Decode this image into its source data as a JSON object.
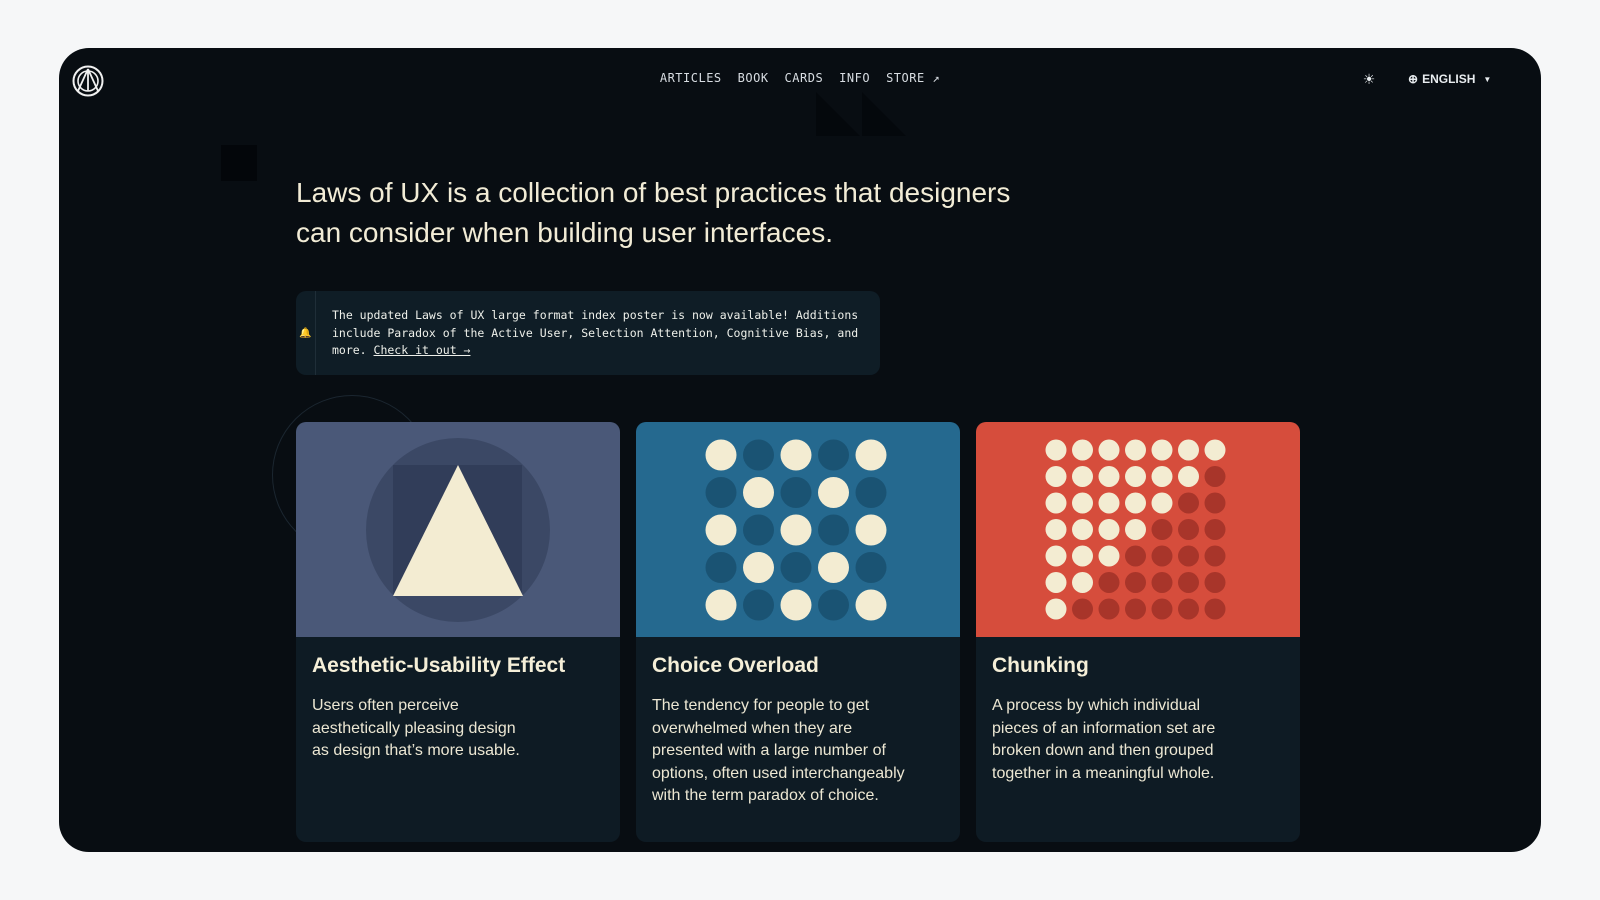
{
  "colors": {
    "background": "#080d12",
    "cream": "#f2ecd6",
    "card_bg": "#0e1b24",
    "card1_art": "#4a5878",
    "card2_art": "#25698f",
    "card3_art": "#d64d3c"
  },
  "header": {
    "logo_icon": "laws-of-ux-logo",
    "nav": [
      {
        "label": "ARTICLES"
      },
      {
        "label": "BOOK"
      },
      {
        "label": "CARDS"
      },
      {
        "label": "INFO"
      },
      {
        "label": "STORE ↗"
      }
    ],
    "theme_icon": "sun-icon",
    "language": "ENGLISH"
  },
  "hero": {
    "text": "Laws of UX is a collection of best practices that designers can consider when building user interfaces."
  },
  "notice": {
    "icon": "bell-icon",
    "text": "The updated Laws of UX large format index poster is now available! Additions include Paradox of the Active User, Selection Attention, Cognitive Bias, and more. ",
    "link": "Check it out →"
  },
  "cards": [
    {
      "title": "Aesthetic-Usability Effect",
      "description": "Users often perceive aesthetically pleasing design as design that’s more usable."
    },
    {
      "title": "Choice Overload",
      "description": "The tendency for people to get overwhelmed when they are presented with a large number of options, often used interchangeably with the term paradox of choice."
    },
    {
      "title": "Chunking",
      "description": "A process by which individual pieces of an information set are broken down and then grouped together in a meaningful whole."
    }
  ]
}
